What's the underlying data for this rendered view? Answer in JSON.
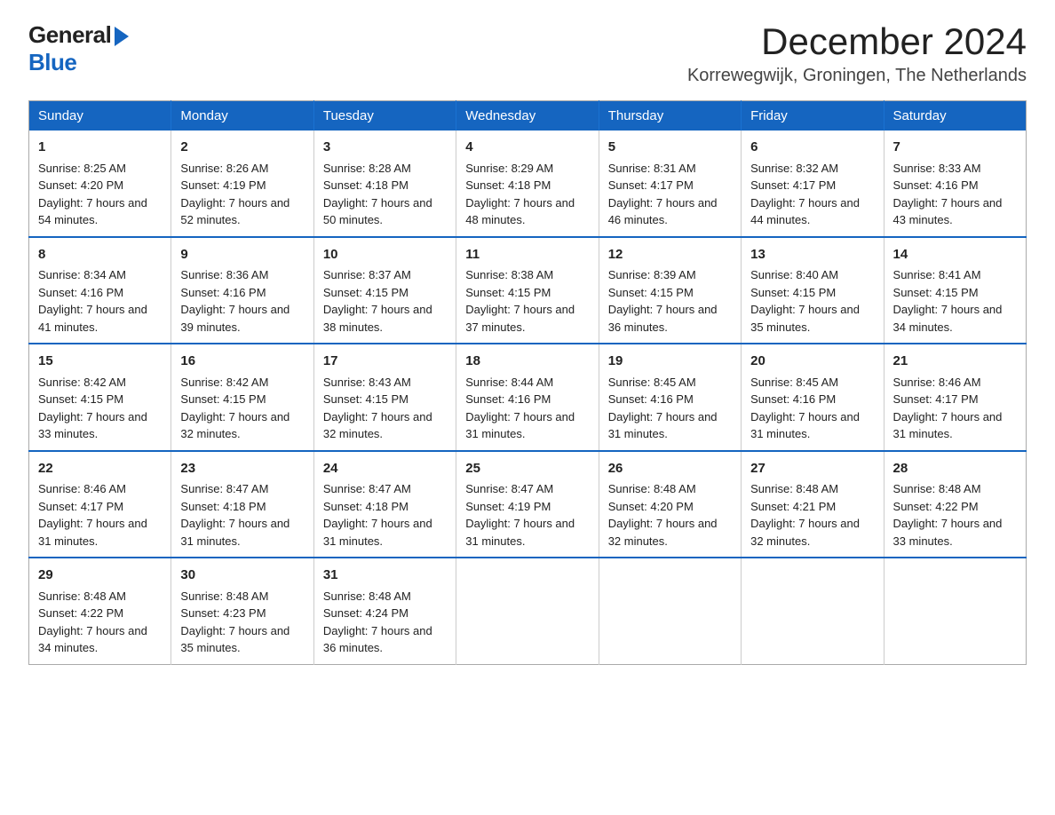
{
  "header": {
    "logo_general": "General",
    "logo_blue": "Blue",
    "title": "December 2024",
    "location": "Korrewegwijk, Groningen, The Netherlands"
  },
  "days_of_week": [
    "Sunday",
    "Monday",
    "Tuesday",
    "Wednesday",
    "Thursday",
    "Friday",
    "Saturday"
  ],
  "weeks": [
    [
      {
        "day": "1",
        "sunrise": "Sunrise: 8:25 AM",
        "sunset": "Sunset: 4:20 PM",
        "daylight": "Daylight: 7 hours and 54 minutes."
      },
      {
        "day": "2",
        "sunrise": "Sunrise: 8:26 AM",
        "sunset": "Sunset: 4:19 PM",
        "daylight": "Daylight: 7 hours and 52 minutes."
      },
      {
        "day": "3",
        "sunrise": "Sunrise: 8:28 AM",
        "sunset": "Sunset: 4:18 PM",
        "daylight": "Daylight: 7 hours and 50 minutes."
      },
      {
        "day": "4",
        "sunrise": "Sunrise: 8:29 AM",
        "sunset": "Sunset: 4:18 PM",
        "daylight": "Daylight: 7 hours and 48 minutes."
      },
      {
        "day": "5",
        "sunrise": "Sunrise: 8:31 AM",
        "sunset": "Sunset: 4:17 PM",
        "daylight": "Daylight: 7 hours and 46 minutes."
      },
      {
        "day": "6",
        "sunrise": "Sunrise: 8:32 AM",
        "sunset": "Sunset: 4:17 PM",
        "daylight": "Daylight: 7 hours and 44 minutes."
      },
      {
        "day": "7",
        "sunrise": "Sunrise: 8:33 AM",
        "sunset": "Sunset: 4:16 PM",
        "daylight": "Daylight: 7 hours and 43 minutes."
      }
    ],
    [
      {
        "day": "8",
        "sunrise": "Sunrise: 8:34 AM",
        "sunset": "Sunset: 4:16 PM",
        "daylight": "Daylight: 7 hours and 41 minutes."
      },
      {
        "day": "9",
        "sunrise": "Sunrise: 8:36 AM",
        "sunset": "Sunset: 4:16 PM",
        "daylight": "Daylight: 7 hours and 39 minutes."
      },
      {
        "day": "10",
        "sunrise": "Sunrise: 8:37 AM",
        "sunset": "Sunset: 4:15 PM",
        "daylight": "Daylight: 7 hours and 38 minutes."
      },
      {
        "day": "11",
        "sunrise": "Sunrise: 8:38 AM",
        "sunset": "Sunset: 4:15 PM",
        "daylight": "Daylight: 7 hours and 37 minutes."
      },
      {
        "day": "12",
        "sunrise": "Sunrise: 8:39 AM",
        "sunset": "Sunset: 4:15 PM",
        "daylight": "Daylight: 7 hours and 36 minutes."
      },
      {
        "day": "13",
        "sunrise": "Sunrise: 8:40 AM",
        "sunset": "Sunset: 4:15 PM",
        "daylight": "Daylight: 7 hours and 35 minutes."
      },
      {
        "day": "14",
        "sunrise": "Sunrise: 8:41 AM",
        "sunset": "Sunset: 4:15 PM",
        "daylight": "Daylight: 7 hours and 34 minutes."
      }
    ],
    [
      {
        "day": "15",
        "sunrise": "Sunrise: 8:42 AM",
        "sunset": "Sunset: 4:15 PM",
        "daylight": "Daylight: 7 hours and 33 minutes."
      },
      {
        "day": "16",
        "sunrise": "Sunrise: 8:42 AM",
        "sunset": "Sunset: 4:15 PM",
        "daylight": "Daylight: 7 hours and 32 minutes."
      },
      {
        "day": "17",
        "sunrise": "Sunrise: 8:43 AM",
        "sunset": "Sunset: 4:15 PM",
        "daylight": "Daylight: 7 hours and 32 minutes."
      },
      {
        "day": "18",
        "sunrise": "Sunrise: 8:44 AM",
        "sunset": "Sunset: 4:16 PM",
        "daylight": "Daylight: 7 hours and 31 minutes."
      },
      {
        "day": "19",
        "sunrise": "Sunrise: 8:45 AM",
        "sunset": "Sunset: 4:16 PM",
        "daylight": "Daylight: 7 hours and 31 minutes."
      },
      {
        "day": "20",
        "sunrise": "Sunrise: 8:45 AM",
        "sunset": "Sunset: 4:16 PM",
        "daylight": "Daylight: 7 hours and 31 minutes."
      },
      {
        "day": "21",
        "sunrise": "Sunrise: 8:46 AM",
        "sunset": "Sunset: 4:17 PM",
        "daylight": "Daylight: 7 hours and 31 minutes."
      }
    ],
    [
      {
        "day": "22",
        "sunrise": "Sunrise: 8:46 AM",
        "sunset": "Sunset: 4:17 PM",
        "daylight": "Daylight: 7 hours and 31 minutes."
      },
      {
        "day": "23",
        "sunrise": "Sunrise: 8:47 AM",
        "sunset": "Sunset: 4:18 PM",
        "daylight": "Daylight: 7 hours and 31 minutes."
      },
      {
        "day": "24",
        "sunrise": "Sunrise: 8:47 AM",
        "sunset": "Sunset: 4:18 PM",
        "daylight": "Daylight: 7 hours and 31 minutes."
      },
      {
        "day": "25",
        "sunrise": "Sunrise: 8:47 AM",
        "sunset": "Sunset: 4:19 PM",
        "daylight": "Daylight: 7 hours and 31 minutes."
      },
      {
        "day": "26",
        "sunrise": "Sunrise: 8:48 AM",
        "sunset": "Sunset: 4:20 PM",
        "daylight": "Daylight: 7 hours and 32 minutes."
      },
      {
        "day": "27",
        "sunrise": "Sunrise: 8:48 AM",
        "sunset": "Sunset: 4:21 PM",
        "daylight": "Daylight: 7 hours and 32 minutes."
      },
      {
        "day": "28",
        "sunrise": "Sunrise: 8:48 AM",
        "sunset": "Sunset: 4:22 PM",
        "daylight": "Daylight: 7 hours and 33 minutes."
      }
    ],
    [
      {
        "day": "29",
        "sunrise": "Sunrise: 8:48 AM",
        "sunset": "Sunset: 4:22 PM",
        "daylight": "Daylight: 7 hours and 34 minutes."
      },
      {
        "day": "30",
        "sunrise": "Sunrise: 8:48 AM",
        "sunset": "Sunset: 4:23 PM",
        "daylight": "Daylight: 7 hours and 35 minutes."
      },
      {
        "day": "31",
        "sunrise": "Sunrise: 8:48 AM",
        "sunset": "Sunset: 4:24 PM",
        "daylight": "Daylight: 7 hours and 36 minutes."
      },
      {
        "day": "",
        "sunrise": "",
        "sunset": "",
        "daylight": ""
      },
      {
        "day": "",
        "sunrise": "",
        "sunset": "",
        "daylight": ""
      },
      {
        "day": "",
        "sunrise": "",
        "sunset": "",
        "daylight": ""
      },
      {
        "day": "",
        "sunrise": "",
        "sunset": "",
        "daylight": ""
      }
    ]
  ]
}
